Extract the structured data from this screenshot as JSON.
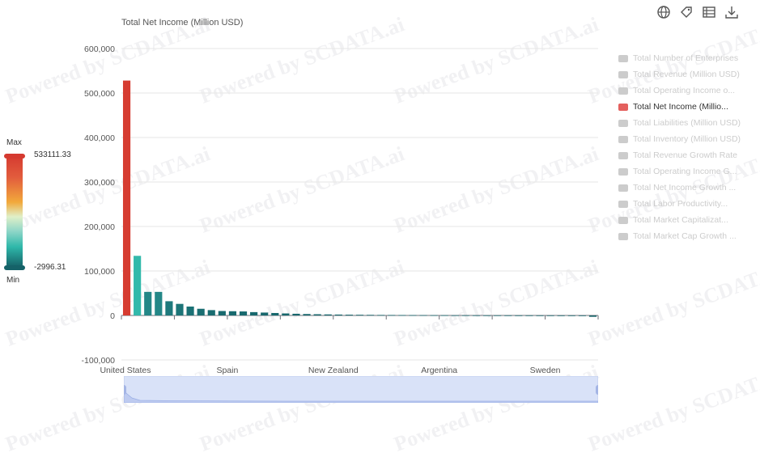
{
  "chart_title": "Total Net Income (Million USD)",
  "watermark": "Powered by SCDATA.ai",
  "toolbar": {
    "icons": [
      "globe-icon",
      "tag-icon",
      "table-icon",
      "download-icon"
    ]
  },
  "visual_map": {
    "max_label": "Max",
    "min_label": "Min",
    "max_value": "533111.33",
    "min_value": "-2996.31",
    "colors": [
      "#d53a30",
      "#f2a93b",
      "#8fd6c8",
      "#2fb8aa",
      "#156268"
    ]
  },
  "legend": {
    "items": [
      {
        "label": "Total Number of Enterprises",
        "active": false
      },
      {
        "label": "Total Revenue (Million USD)",
        "active": false
      },
      {
        "label": "Total Operating Income o...",
        "active": false
      },
      {
        "label": "Total Net Income (Millio...",
        "active": true
      },
      {
        "label": "Total Liabilities (Million USD)",
        "active": false
      },
      {
        "label": "Total Inventory (Million USD)",
        "active": false
      },
      {
        "label": "Total Revenue Growth Rate",
        "active": false
      },
      {
        "label": "Total Operating Income G...",
        "active": false
      },
      {
        "label": "Total Net Income Growth ...",
        "active": false
      },
      {
        "label": "Total Labor Productivity...",
        "active": false
      },
      {
        "label": "Total Market Capitalizat...",
        "active": false
      },
      {
        "label": "Total Market Cap Growth ...",
        "active": false
      }
    ]
  },
  "chart_data": {
    "type": "bar",
    "title": "Total Net Income (Million USD)",
    "ylim": [
      -100000,
      600000
    ],
    "yticks": [
      -100000,
      0,
      100000,
      200000,
      300000,
      400000,
      500000,
      600000
    ],
    "ytick_labels": [
      "-100,000",
      "0",
      "100,000",
      "200,000",
      "300,000",
      "400,000",
      "500,000",
      "600,000"
    ],
    "xtick_labels": [
      {
        "index": 0,
        "label": "United States"
      },
      {
        "index": 10,
        "label": "Spain"
      },
      {
        "index": 20,
        "label": "New Zealand"
      },
      {
        "index": 30,
        "label": "Argentina"
      },
      {
        "index": 40,
        "label": "Sweden"
      }
    ],
    "grid": true,
    "values": [
      528000,
      134000,
      53000,
      53000,
      32000,
      26000,
      20000,
      15000,
      12000,
      10000,
      9500,
      9000,
      7500,
      6500,
      5500,
      4500,
      3800,
      3200,
      2700,
      2300,
      2000,
      1700,
      1500,
      1300,
      1100,
      1000,
      900,
      800,
      700,
      600,
      500,
      450,
      400,
      350,
      300,
      300,
      250,
      200,
      200,
      150,
      150,
      100,
      100,
      50,
      -2996.31
    ]
  }
}
